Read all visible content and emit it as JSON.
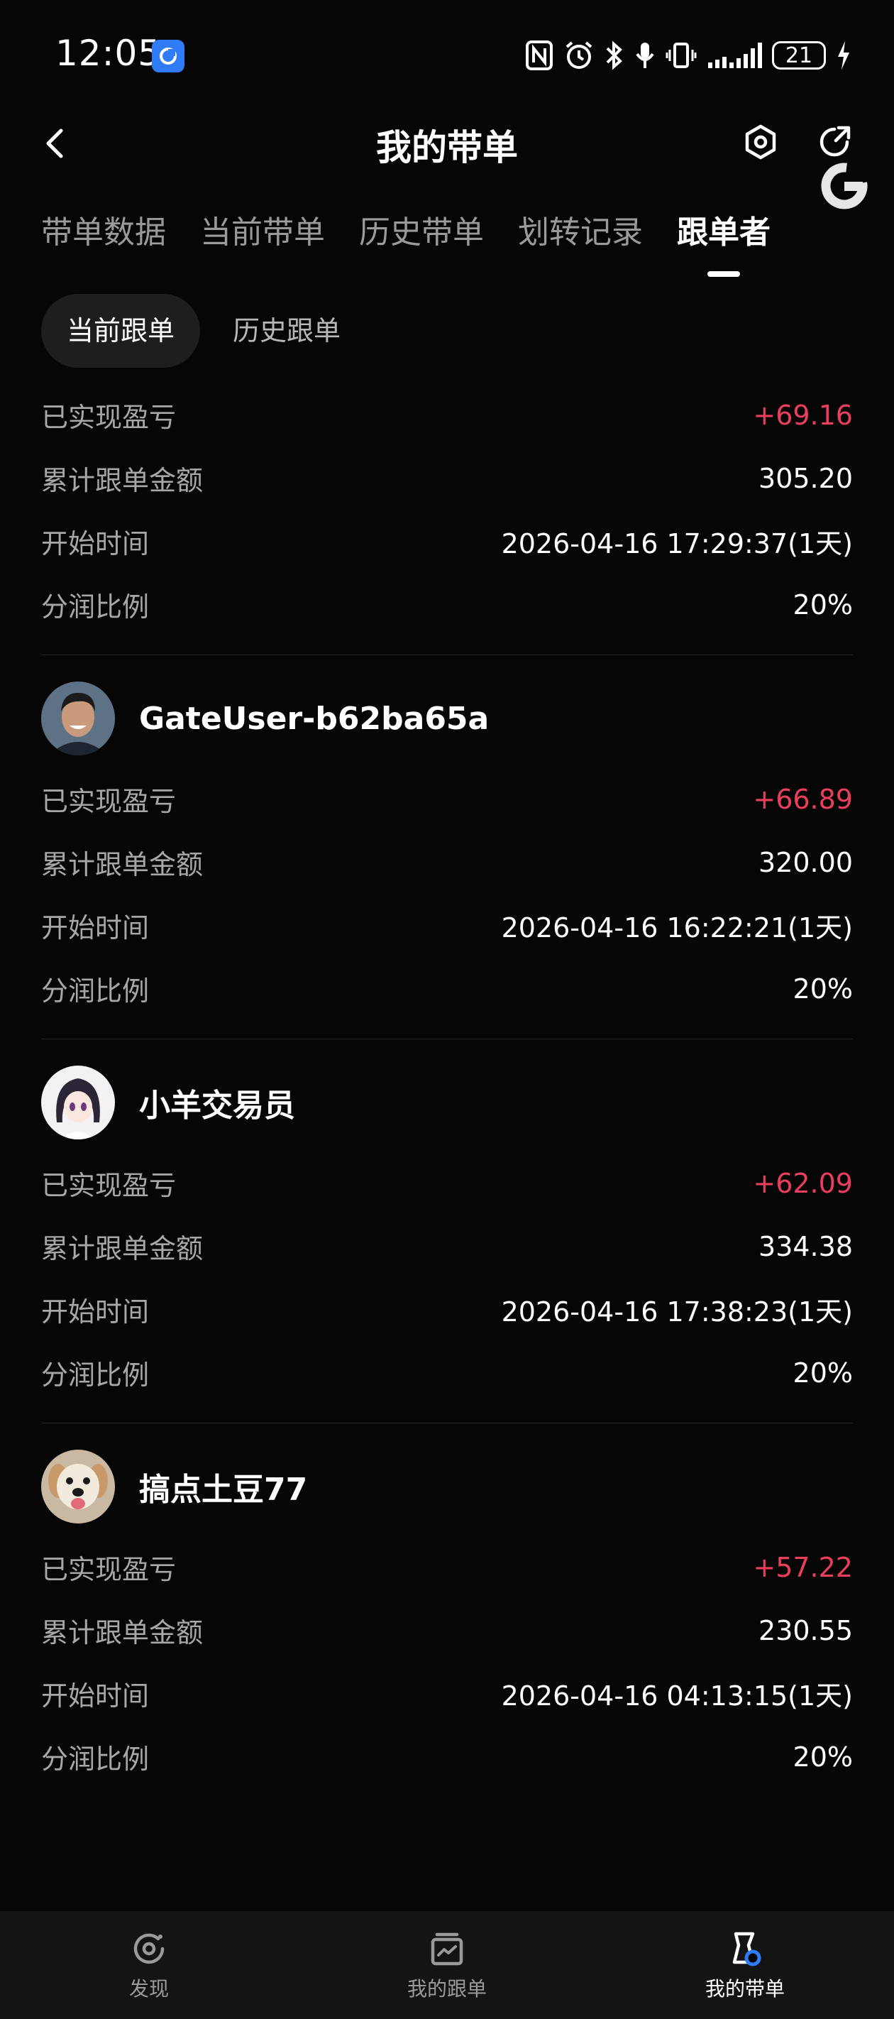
{
  "status_bar": {
    "time": "12:05",
    "battery": "21"
  },
  "header": {
    "title": "我的带单",
    "back_icon": "chevron-left-icon",
    "settings_icon": "gear-icon",
    "share_icon": "share-icon"
  },
  "tabs": [
    {
      "label": "带单数据",
      "active": false
    },
    {
      "label": "当前带单",
      "active": false
    },
    {
      "label": "历史带单",
      "active": false
    },
    {
      "label": "划转记录",
      "active": false
    },
    {
      "label": "跟单者",
      "active": true
    }
  ],
  "subtabs": [
    {
      "label": "当前跟单",
      "active": true
    },
    {
      "label": "历史跟单",
      "active": false
    }
  ],
  "labels": {
    "pnl": "已实现盈亏",
    "amount": "累计跟单金额",
    "start": "开始时间",
    "share": "分润比例"
  },
  "followers": [
    {
      "name": "",
      "avatar": "none",
      "pnl": "+69.16",
      "amount": "305.20",
      "start": "2026-04-16 17:29:37(1天)",
      "share": "20%"
    },
    {
      "name": "GateUser-b62ba65a",
      "avatar": "photo-avatar",
      "pnl": "+66.89",
      "amount": "320.00",
      "start": "2026-04-16 16:22:21(1天)",
      "share": "20%"
    },
    {
      "name": "小羊交易员",
      "avatar": "anime-avatar",
      "pnl": "+62.09",
      "amount": "334.38",
      "start": "2026-04-16 17:38:23(1天)",
      "share": "20%"
    },
    {
      "name": "搞点土豆77",
      "avatar": "dog-avatar",
      "pnl": "+57.22",
      "amount": "230.55",
      "start": "2026-04-16 04:13:15(1天)",
      "share": "20%"
    }
  ],
  "bottom_nav": [
    {
      "label": "发现",
      "icon": "discover-icon",
      "active": false
    },
    {
      "label": "我的跟单",
      "icon": "copy-trade-icon",
      "active": false
    },
    {
      "label": "我的带单",
      "icon": "lead-trade-icon",
      "active": true
    }
  ],
  "colors": {
    "background": "#060606",
    "profit": "#ea3e5d",
    "label": "#a7a7a7",
    "accent": "#2f7cf6"
  }
}
